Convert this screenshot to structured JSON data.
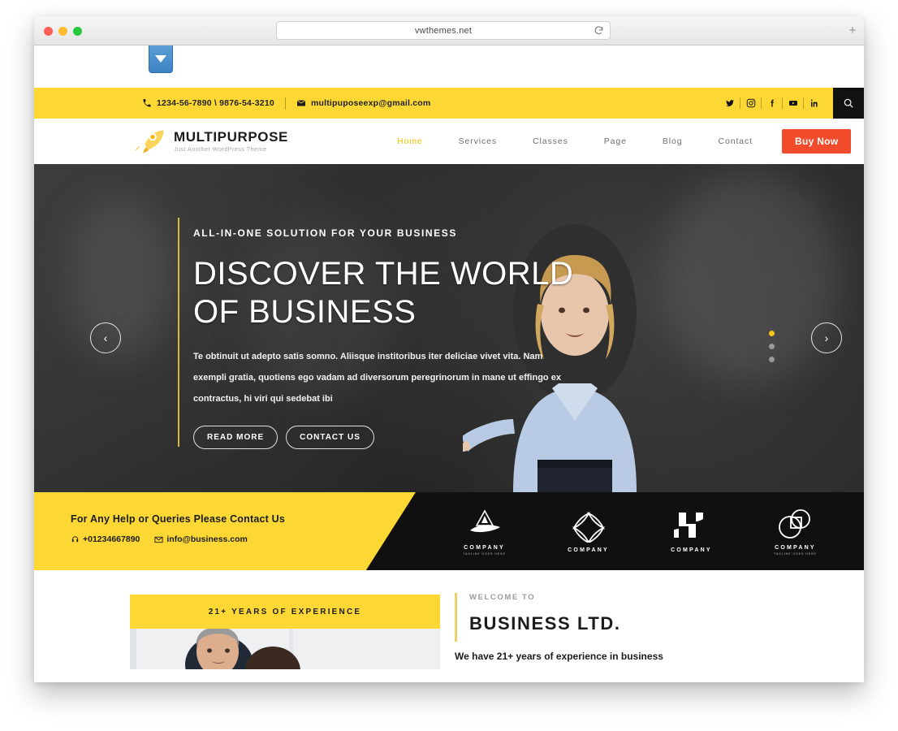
{
  "browser": {
    "url": "vwthemes.net",
    "reload_icon": "reload-icon",
    "new_tab_icon": "plus-icon",
    "dropdown_icon": "chevron-down-icon"
  },
  "topbar": {
    "phones": "1234-56-7890  \\  9876-54-3210",
    "phone_icon": "phone-icon",
    "email": "multipuposeexp@gmail.com",
    "email_icon": "envelope-icon",
    "socials": [
      {
        "name": "twitter-icon",
        "label": "Twitter"
      },
      {
        "name": "instagram-icon",
        "label": "Instagram"
      },
      {
        "name": "facebook-icon",
        "label": "Facebook"
      },
      {
        "name": "youtube-icon",
        "label": "YouTube"
      },
      {
        "name": "linkedin-icon",
        "label": "LinkedIn"
      }
    ],
    "search_icon": "search-icon",
    "bg_color": "#FDD835"
  },
  "header": {
    "logo_title": "MULTIPURPOSE",
    "logo_sub": "Just Another WordPress Theme",
    "logo_icon": "rocket-icon",
    "nav": [
      {
        "label": "Home",
        "active": true
      },
      {
        "label": "Services",
        "active": false
      },
      {
        "label": "Classes",
        "active": false
      },
      {
        "label": "Page",
        "active": false
      },
      {
        "label": "Blog",
        "active": false
      },
      {
        "label": "Contact",
        "active": false
      }
    ],
    "buy_label": "Buy Now",
    "buy_color": "#F04B2A",
    "active_color": "#F2C200"
  },
  "hero": {
    "kicker": "ALL-IN-ONE SOLUTION FOR YOUR BUSINESS",
    "title": "DISCOVER THE WORLD OF BUSINESS",
    "paragraph": "Te obtinuit ut adepto satis somno. Aliisque institoribus iter deliciae vivet vita. Nam exempli gratia, quotiens ego vadam ad diversorum peregrinorum in mane ut effingo ex contractus, hi viri qui sedebat ibi",
    "btn_read_more": "READ MORE",
    "btn_contact_us": "CONTACT US",
    "prev_icon": "chevron-left-icon",
    "next_icon": "chevron-right-icon",
    "prev_glyph": "‹",
    "next_glyph": "›",
    "dots": [
      true,
      false,
      false
    ],
    "accent_color": "#D9B93A",
    "active_dot_color": "#F5C518"
  },
  "strip": {
    "title": "For Any Help or Queries Please Contact Us",
    "phone": "+01234667890",
    "phone_icon": "headset-icon",
    "email": "info@business.com",
    "email_icon": "envelope-icon",
    "brands": [
      {
        "name": "COMPANY",
        "tagline": "TAGLINE GOES HERE",
        "icon": "company-logo-a-icon"
      },
      {
        "name": "COMPANY",
        "tagline": "",
        "icon": "company-logo-diamond-icon"
      },
      {
        "name": "COMPANY",
        "tagline": "",
        "icon": "company-logo-h-icon"
      },
      {
        "name": "COMPANY",
        "tagline": "TAGLINE GOES HERE",
        "icon": "company-logo-circles-icon"
      }
    ],
    "bg_color": "#101010",
    "yellow_color": "#FDD835"
  },
  "about": {
    "experience_banner": "21+ YEARS OF EXPERIENCE",
    "welcome_label": "WELCOME TO",
    "welcome_title": "BUSINESS LTD.",
    "welcome_sub": "We have 21+ years of experience in business"
  }
}
